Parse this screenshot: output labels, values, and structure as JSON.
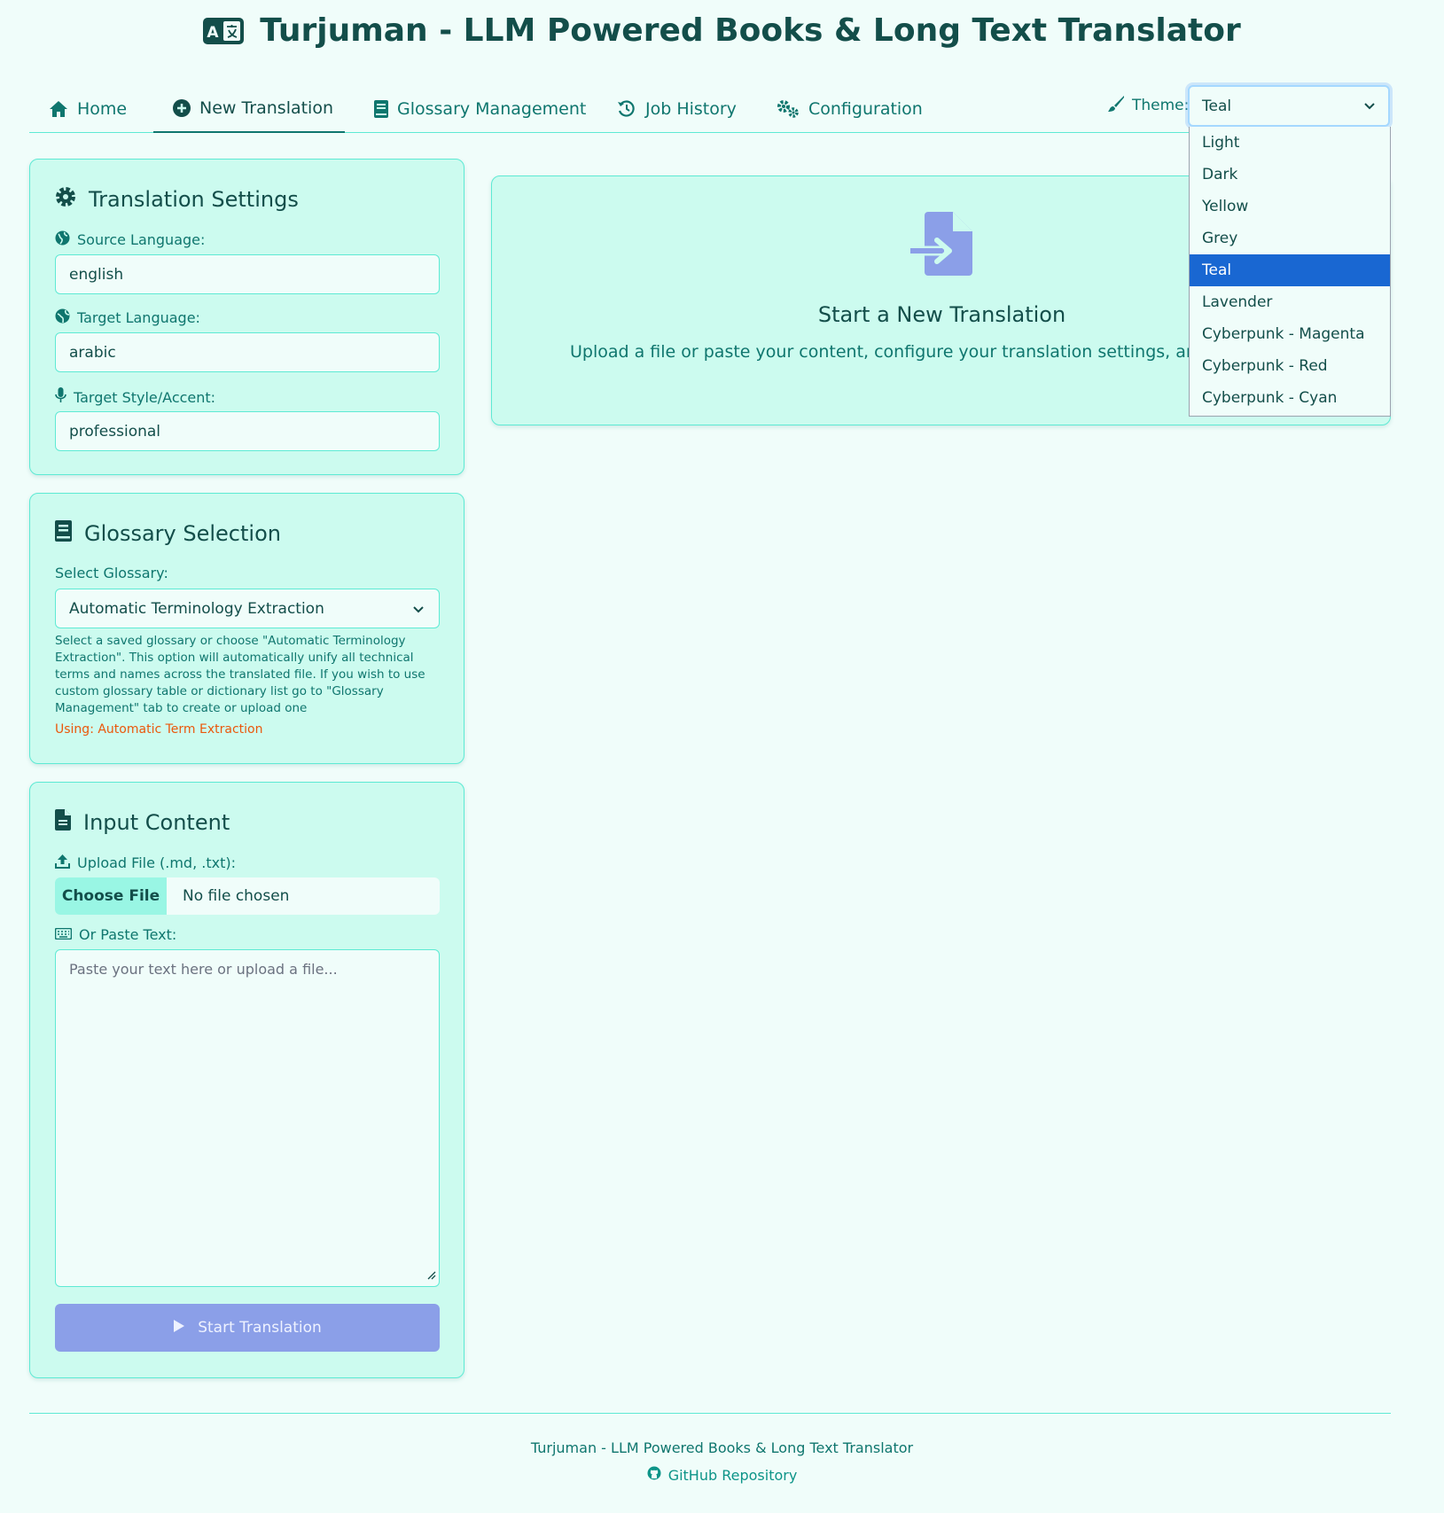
{
  "header": {
    "title": "Turjuman - LLM Powered Books & Long Text Translator"
  },
  "nav": {
    "items": [
      {
        "label": "Home",
        "icon": "home-icon"
      },
      {
        "label": "New Translation",
        "icon": "plus-circle-icon",
        "active": true
      },
      {
        "label": "Glossary Management",
        "icon": "book-icon"
      },
      {
        "label": "Job History",
        "icon": "history-icon"
      },
      {
        "label": "Configuration",
        "icon": "gears-icon"
      }
    ],
    "theme_label": "Theme:",
    "theme_value": "Teal",
    "theme_options": [
      "Light",
      "Dark",
      "Yellow",
      "Grey",
      "Teal",
      "Lavender",
      "Cyberpunk - Magenta",
      "Cyberpunk - Red",
      "Cyberpunk - Cyan"
    ]
  },
  "settings": {
    "title": "Translation Settings",
    "source_label": "Source Language:",
    "source_value": "english",
    "target_label": "Target Language:",
    "target_value": "arabic",
    "style_label": "Target Style/Accent:",
    "style_value": "professional"
  },
  "glossary": {
    "title": "Glossary Selection",
    "select_label": "Select Glossary:",
    "selected": "Automatic Terminology Extraction",
    "help": "Select a saved glossary or choose \"Automatic Terminology Extraction\". This option will automatically unify all technical terms and names across the translated file. If you wish to use custom glossary table or dictionary list go to \"Glossary Management\" tab to create or upload one",
    "status": "Using: Automatic Term Extraction"
  },
  "input": {
    "title": "Input Content",
    "upload_label": "Upload File (.md, .txt):",
    "choose_file": "Choose File",
    "no_file": "No file chosen",
    "paste_label": "Or Paste Text:",
    "paste_placeholder": "Paste your text here or upload a file...",
    "start_button": "Start Translation"
  },
  "welcome": {
    "title": "Start a New Translation",
    "text": "Upload a file or paste your content, configure your translation settings, and click \"S"
  },
  "footer": {
    "text": "Turjuman - LLM Powered Books & Long Text Translator",
    "link": "GitHub Repository"
  },
  "colors": {
    "background": "#f0fdfa",
    "card": "#ccfbef",
    "border": "#5eead4",
    "primary_text": "#134e4a",
    "accent": "#0f766e",
    "button": "#8b9fe8",
    "selected_option": "#1967d2",
    "warning": "#ea580c"
  }
}
